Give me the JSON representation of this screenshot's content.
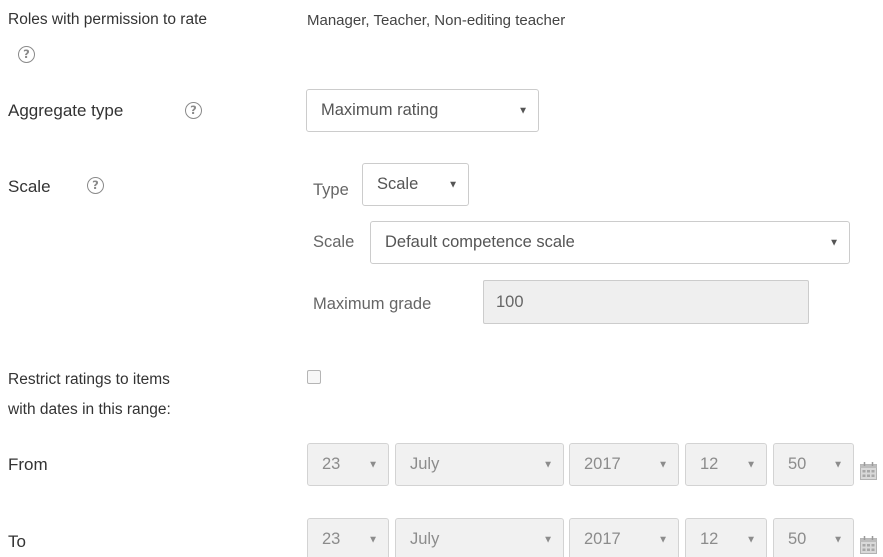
{
  "rating_roles": {
    "label": "Roles with permission to rate",
    "value": "Manager, Teacher, Non-editing teacher"
  },
  "aggregate_type": {
    "label": "Aggregate type",
    "selected": "Maximum rating"
  },
  "scale": {
    "label": "Scale",
    "type_label": "Type",
    "type_selected": "Scale",
    "scale_label": "Scale",
    "scale_selected": "Default competence scale",
    "max_grade_label": "Maximum grade",
    "max_grade_value": "100"
  },
  "restrict": {
    "label_line1": "Restrict ratings to items",
    "label_line2": "with dates in this range:",
    "checked": false
  },
  "from": {
    "label": "From",
    "day": "23",
    "month": "July",
    "year": "2017",
    "hour": "12",
    "minute": "50"
  },
  "to": {
    "label": "To",
    "day": "23",
    "month": "July",
    "year": "2017",
    "hour": "12",
    "minute": "50"
  },
  "icons": {
    "help": "?",
    "caret": "▼"
  },
  "colors": {
    "text": "#333333",
    "muted": "#8a8a8a",
    "disabled_bg": "#f1f1f1",
    "border": "#cccccc"
  }
}
